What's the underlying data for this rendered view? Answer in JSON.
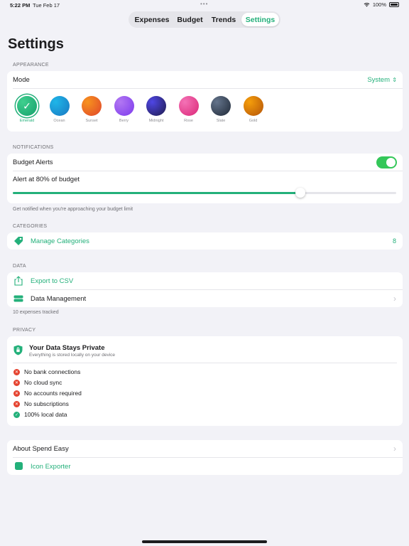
{
  "status": {
    "time": "5:22 PM",
    "date": "Tue Feb 17",
    "battery": "100%",
    "dots": "•••"
  },
  "tabs": [
    {
      "label": "Expenses",
      "active": false
    },
    {
      "label": "Budget",
      "active": false
    },
    {
      "label": "Trends",
      "active": false
    },
    {
      "label": "Settings",
      "active": true
    }
  ],
  "page_title": "Settings",
  "appearance": {
    "section": "APPEARANCE",
    "mode_label": "Mode",
    "mode_value": "System",
    "themes": [
      {
        "name": "Emerald",
        "selected": true,
        "from": "#3fcf8e",
        "to": "#16a06c"
      },
      {
        "name": "Ocean",
        "selected": false,
        "from": "#1fb6e8",
        "to": "#1a78c2"
      },
      {
        "name": "Sunset",
        "selected": false,
        "from": "#f7931e",
        "to": "#e0452b"
      },
      {
        "name": "Berry",
        "selected": false,
        "from": "#b277f2",
        "to": "#7c3aed"
      },
      {
        "name": "Midnight",
        "selected": false,
        "from": "#4f46e5",
        "to": "#1e1b4b"
      },
      {
        "name": "Rose",
        "selected": false,
        "from": "#f472b6",
        "to": "#db2777"
      },
      {
        "name": "Slate",
        "selected": false,
        "from": "#64748b",
        "to": "#1f2937"
      },
      {
        "name": "Gold",
        "selected": false,
        "from": "#f59e0b",
        "to": "#b45309"
      }
    ]
  },
  "notifications": {
    "section": "NOTIFICATIONS",
    "budget_alerts_label": "Budget Alerts",
    "budget_alerts_on": true,
    "alert_label": "Alert at 80% of budget",
    "alert_threshold": 0.75,
    "footer": "Get notified when you're approaching your budget limit"
  },
  "categories": {
    "section": "CATEGORIES",
    "manage_label": "Manage Categories",
    "count": "8"
  },
  "data": {
    "section": "DATA",
    "export_label": "Export to CSV",
    "management_label": "Data Management",
    "footer": "10 expenses tracked"
  },
  "privacy": {
    "section": "PRIVACY",
    "title": "Your Data Stays Private",
    "subtitle": "Everything is stored locally on your device",
    "items": [
      {
        "text": "No bank connections",
        "status": "no"
      },
      {
        "text": "No cloud sync",
        "status": "no"
      },
      {
        "text": "No accounts required",
        "status": "no"
      },
      {
        "text": "No subscriptions",
        "status": "no"
      },
      {
        "text": "100% local data",
        "status": "yes"
      }
    ]
  },
  "about": {
    "about_label": "About Spend Easy",
    "icon_exporter_label": "Icon Exporter"
  },
  "colors": {
    "accent": "#23b07a",
    "background": "#f2f2f7",
    "destructive": "#e5432f"
  }
}
